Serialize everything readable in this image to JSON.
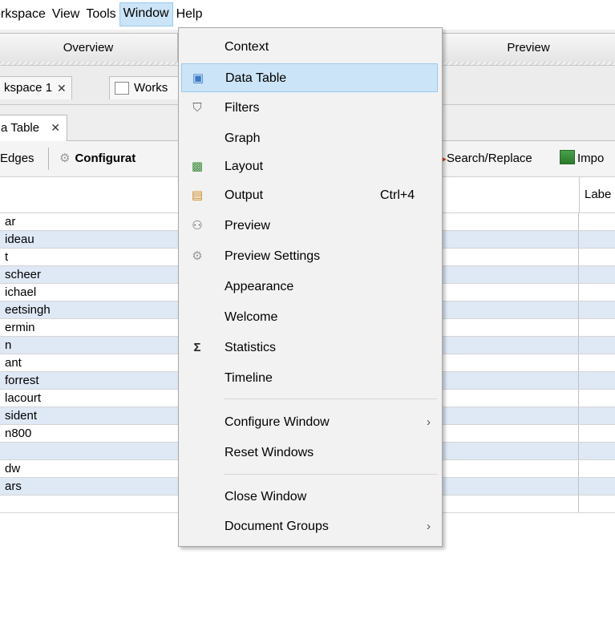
{
  "menubar": {
    "items": [
      "orkspace",
      "View",
      "Tools",
      "Window",
      "Help"
    ]
  },
  "toolbar": {
    "overview_label": "Overview",
    "preview_label": "Preview"
  },
  "workspace_tabs": {
    "tab1_label": "kspace 1",
    "tab2_label": "Works",
    "close_glyph": "✕"
  },
  "doc_tab": {
    "label": "a Table",
    "close_glyph": "✕"
  },
  "data_toolbar": {
    "edges_label": "Edges",
    "config_label": "Configurat",
    "search_replace_label": "Search/Replace",
    "import_label": "Impo"
  },
  "table": {
    "header_col2": "Labe",
    "rows": [
      "ar",
      "ideau",
      "t",
      "scheer",
      "ichael",
      "eetsingh",
      "ermin",
      "n",
      "ant",
      "forrest",
      "lacourt",
      "sident",
      "n800",
      "",
      "dw",
      "ars",
      ""
    ]
  },
  "window_menu": {
    "items": [
      {
        "label": "Context",
        "icon": "",
        "shortcut": "",
        "submenu": false
      },
      {
        "label": "Data Table",
        "icon": "data-table-icon",
        "shortcut": "",
        "submenu": false,
        "highlighted": true
      },
      {
        "label": "Filters",
        "icon": "filter-icon",
        "shortcut": "",
        "submenu": false
      },
      {
        "label": "Graph",
        "icon": "",
        "shortcut": "",
        "submenu": false
      },
      {
        "label": "Layout",
        "icon": "layout-icon",
        "shortcut": "",
        "submenu": false
      },
      {
        "label": "Output",
        "icon": "output-icon",
        "shortcut": "Ctrl+4",
        "submenu": false
      },
      {
        "label": "Preview",
        "icon": "glasses-icon",
        "shortcut": "",
        "submenu": false
      },
      {
        "label": "Preview Settings",
        "icon": "gear-icon",
        "shortcut": "",
        "submenu": false
      },
      {
        "label": "Appearance",
        "icon": "",
        "shortcut": "",
        "submenu": false
      },
      {
        "label": "Welcome",
        "icon": "",
        "shortcut": "",
        "submenu": false
      },
      {
        "label": "Statistics",
        "icon": "sigma-icon",
        "shortcut": "",
        "submenu": false
      },
      {
        "label": "Timeline",
        "icon": "",
        "shortcut": "",
        "submenu": false
      },
      {
        "label": "Configure Window",
        "icon": "",
        "shortcut": "",
        "submenu": true
      },
      {
        "label": "Reset Windows",
        "icon": "",
        "shortcut": "",
        "submenu": false
      },
      {
        "label": "Close Window",
        "icon": "",
        "shortcut": "",
        "submenu": false
      },
      {
        "label": "Document Groups",
        "icon": "",
        "shortcut": "",
        "submenu": true
      }
    ]
  },
  "colors": {
    "highlight": "#cce4f7",
    "row_alt": "#dfe8f5"
  }
}
